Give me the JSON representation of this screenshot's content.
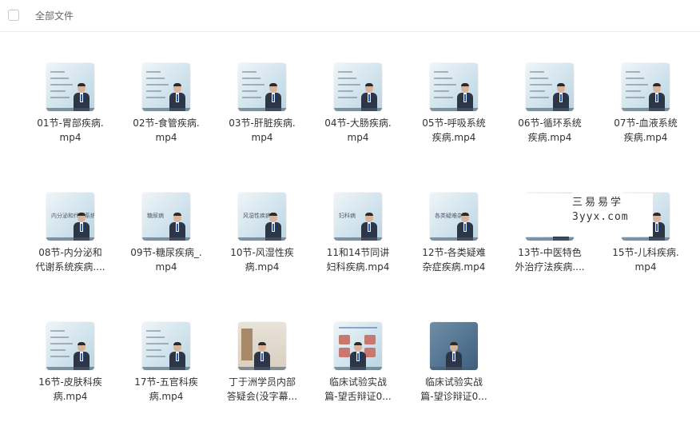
{
  "header": {
    "title": "全部文件"
  },
  "files": [
    {
      "name": "01节-胃部疾病.mp4",
      "line1": "01节-胃部疾病.",
      "line2": "mp4",
      "thumb": "lecture"
    },
    {
      "name": "02节-食管疾病.mp4",
      "line1": "02节-食管疾病.",
      "line2": "mp4",
      "thumb": "lecture"
    },
    {
      "name": "03节-肝脏疾病.mp4",
      "line1": "03节-肝脏疾病.",
      "line2": "mp4",
      "thumb": "lecture"
    },
    {
      "name": "04节-大肠疾病.mp4",
      "line1": "04节-大肠疾病.",
      "line2": "mp4",
      "thumb": "lecture"
    },
    {
      "name": "05节-呼吸系统疾病.mp4",
      "line1": "05节-呼吸系统",
      "line2": "疾病.mp4",
      "thumb": "lecture"
    },
    {
      "name": "06节-循环系统疾病.mp4",
      "line1": "06节-循环系统",
      "line2": "疾病.mp4",
      "thumb": "lecture"
    },
    {
      "name": "07节-血液系统疾病.mp4",
      "line1": "07节-血液系统",
      "line2": "疾病.mp4",
      "thumb": "lecture"
    },
    {
      "name": "08节-内分泌和代谢系统疾病",
      "line1": "08节-内分泌和",
      "line2": "代谢系统疾病....",
      "thumb": "slide",
      "slide_text": "内分泌和代谢系统"
    },
    {
      "name": "09节-糖尿疾病_.mp4",
      "line1": "09节-糖尿疾病_.",
      "line2": "mp4",
      "thumb": "slide",
      "slide_text": "糖尿病"
    },
    {
      "name": "10节-风湿性疾病.mp4",
      "line1": "10节-风湿性疾",
      "line2": "病.mp4",
      "thumb": "slide",
      "slide_text": "风湿性疾病"
    },
    {
      "name": "11和14节同讲妇科疾病.mp4",
      "line1": "11和14节同讲",
      "line2": "妇科疾病.mp4",
      "thumb": "slide",
      "slide_text": "妇科病"
    },
    {
      "name": "12节-各类疑难杂症疾病.mp4",
      "line1": "12节-各类疑难",
      "line2": "杂症疾病.mp4",
      "thumb": "slide",
      "slide_text": "各类疑难杂症"
    },
    {
      "name": "13节-中医特色外治疗法疾病",
      "line1": "13节-中医特色",
      "line2": "外治疗法疾病....",
      "thumb": "slide",
      "slide_text": ""
    },
    {
      "name": "15节-儿科疾病.mp4",
      "line1": "15节-儿科疾病.",
      "line2": "mp4",
      "thumb": "slide",
      "slide_text": ""
    },
    {
      "name": "16节-皮肤科疾病.mp4",
      "line1": "16节-皮肤科疾",
      "line2": "病.mp4",
      "thumb": "lecture"
    },
    {
      "name": "17节-五官科疾病.mp4",
      "line1": "17节-五官科疾",
      "line2": "病.mp4",
      "thumb": "lecture"
    },
    {
      "name": "丁于洲学员内部答疑会(没字幕",
      "line1": "丁于洲学员内部",
      "line2": "答疑会(没字幕...",
      "thumb": "room"
    },
    {
      "name": "临床试验实战篇-望舌辩证0",
      "line1": "临床试验实战",
      "line2": "篇-望舌辩证0...",
      "thumb": "tongue"
    },
    {
      "name": "临床试验实战篇-望诊辩证0",
      "line1": "临床试验实战",
      "line2": "篇-望诊辩证0...",
      "thumb": "dark"
    }
  ],
  "watermark": {
    "line1": "三易易学",
    "line2": "3yyx.com"
  }
}
